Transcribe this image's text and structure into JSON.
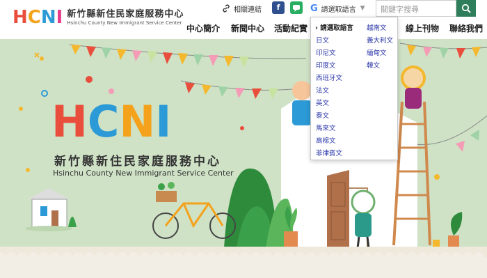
{
  "header": {
    "logo_mark": [
      "H",
      "C",
      "N",
      "I"
    ],
    "logo_title": "新竹縣新住民家庭服務中心",
    "logo_subtitle": "Hsinchu County New Immigrant Service Center",
    "related_links": "相關連結",
    "facebook_icon_glyph": "f",
    "line_icon_glyph": "L",
    "translate_label": "請選取語言",
    "search_placeholder": "關鍵字搜尋",
    "nav": [
      "中心簡介",
      "新聞中心",
      "活動紀實",
      "線上刊物",
      "聯絡我們"
    ]
  },
  "hero": {
    "hcni": [
      "H",
      "C",
      "N",
      "I"
    ],
    "title": "新竹縣新住民家庭服務中心",
    "subtitle": "Hsinchu County New Immigrant Service Center"
  },
  "language_menu": {
    "selected_marker": "›",
    "column1": [
      "請選取語言",
      "日文",
      "印尼文",
      "印度文",
      "西班牙文",
      "法文",
      "英文",
      "泰文",
      "馬來文",
      "高棉文",
      "菲律賓文"
    ],
    "column2": [
      "越南文",
      "義大利文",
      "緬甸文",
      "韓文"
    ]
  },
  "colors": {
    "brand_green": "#2e7d5b",
    "link_blue": "#2b37a8",
    "hero_bg": "#cfe2c6",
    "facebook": "#2f4f8f",
    "line": "#27ae60"
  },
  "icons": [
    "link-icon",
    "facebook-icon",
    "line-icon",
    "google-g-icon",
    "search-icon"
  ]
}
